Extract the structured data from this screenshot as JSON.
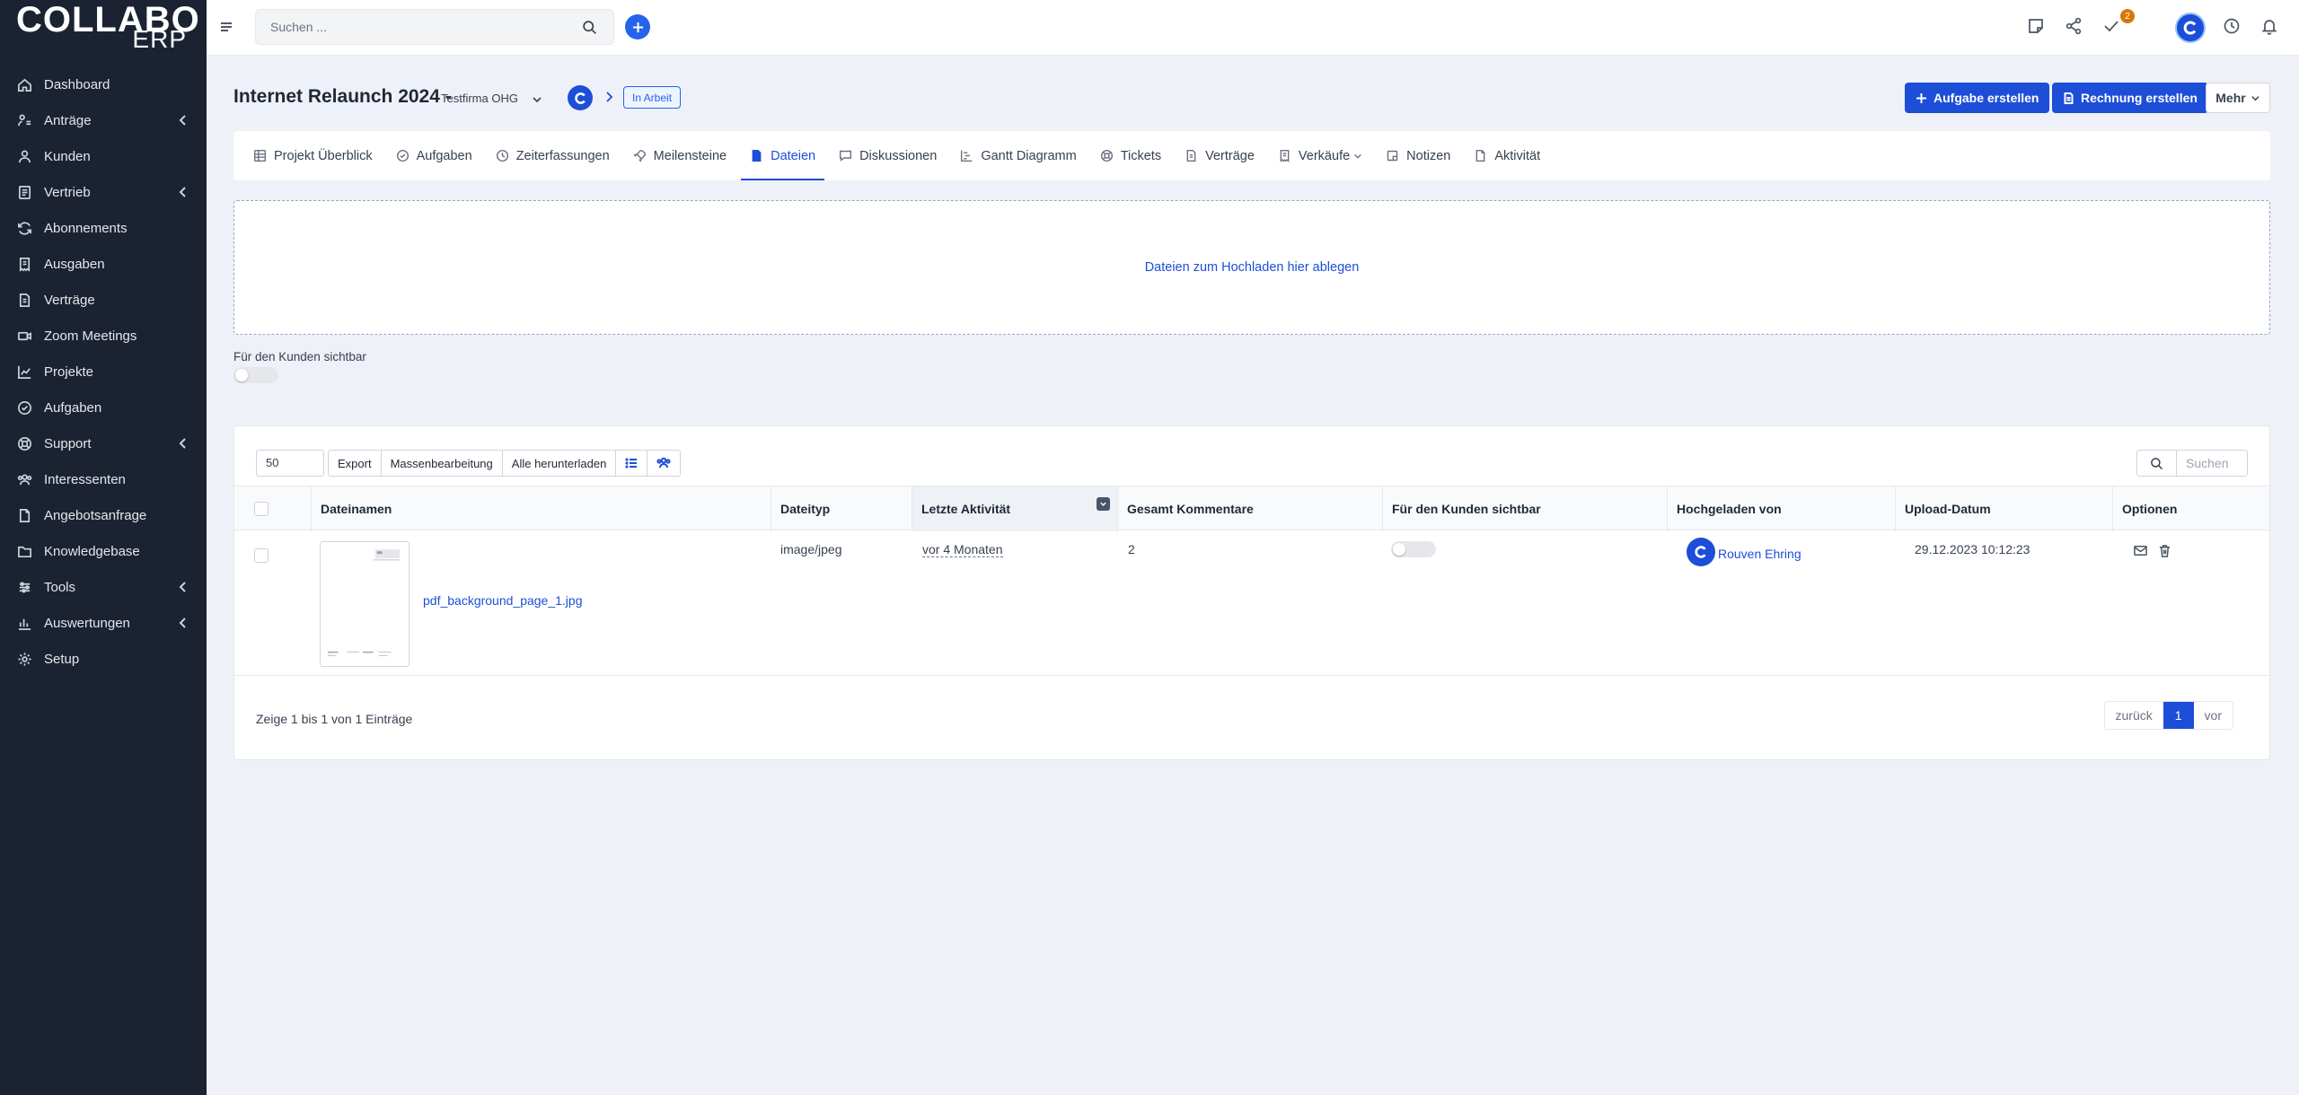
{
  "app": {
    "logo_main": "COLLABO",
    "logo_sub": "ERP"
  },
  "sidebar": {
    "items": [
      {
        "label": "Dashboard",
        "icon": "home-icon",
        "has_submenu": false
      },
      {
        "label": "Anträge",
        "icon": "request-icon",
        "has_submenu": true
      },
      {
        "label": "Kunden",
        "icon": "user-icon",
        "has_submenu": false
      },
      {
        "label": "Vertrieb",
        "icon": "sales-icon",
        "has_submenu": true
      },
      {
        "label": "Abonnements",
        "icon": "refresh-icon",
        "has_submenu": false
      },
      {
        "label": "Ausgaben",
        "icon": "receipt-icon",
        "has_submenu": false
      },
      {
        "label": "Verträge",
        "icon": "contract-icon",
        "has_submenu": false
      },
      {
        "label": "Zoom Meetings",
        "icon": "video-icon",
        "has_submenu": false
      },
      {
        "label": "Projekte",
        "icon": "chart-icon",
        "has_submenu": false
      },
      {
        "label": "Aufgaben",
        "icon": "check-circle-icon",
        "has_submenu": false
      },
      {
        "label": "Support",
        "icon": "lifebuoy-icon",
        "has_submenu": true
      },
      {
        "label": "Interessenten",
        "icon": "users-icon",
        "has_submenu": false
      },
      {
        "label": "Angebotsanfrage",
        "icon": "document-icon",
        "has_submenu": false
      },
      {
        "label": "Knowledgebase",
        "icon": "folder-icon",
        "has_submenu": false
      },
      {
        "label": "Tools",
        "icon": "tools-icon",
        "has_submenu": true
      },
      {
        "label": "Auswertungen",
        "icon": "bar-chart-icon",
        "has_submenu": true
      },
      {
        "label": "Setup",
        "icon": "gear-icon",
        "has_submenu": false
      }
    ]
  },
  "topbar": {
    "search_placeholder": "Suchen ...",
    "todo_badge": "2"
  },
  "project": {
    "title": "Internet Relaunch 2024",
    "separator": "-",
    "company": "Testfirma OHG",
    "status": "In Arbeit"
  },
  "actions": {
    "create_task": "Aufgabe erstellen",
    "create_invoice": "Rechnung erstellen",
    "more": "Mehr"
  },
  "tabs": [
    {
      "label": "Projekt Überblick",
      "icon": "grid-icon",
      "active": false
    },
    {
      "label": "Aufgaben",
      "icon": "check-circle-icon",
      "active": false
    },
    {
      "label": "Zeiterfassungen",
      "icon": "clock-icon",
      "active": false
    },
    {
      "label": "Meilensteine",
      "icon": "rocket-icon",
      "active": false
    },
    {
      "label": "Dateien",
      "icon": "file-icon",
      "active": true
    },
    {
      "label": "Diskussionen",
      "icon": "chat-icon",
      "active": false
    },
    {
      "label": "Gantt Diagramm",
      "icon": "gantt-icon",
      "active": false
    },
    {
      "label": "Tickets",
      "icon": "lifebuoy-icon",
      "active": false
    },
    {
      "label": "Verträge",
      "icon": "contract-icon",
      "active": false
    },
    {
      "label": "Verkäufe",
      "icon": "receipt-icon",
      "active": false
    },
    {
      "label": "Notizen",
      "icon": "note-icon",
      "active": false
    },
    {
      "label": "Aktivität",
      "icon": "document-icon",
      "active": false
    }
  ],
  "dropzone": {
    "text": "Dateien zum Hochladen hier ablegen"
  },
  "visibility": {
    "label": "Für den Kunden sichtbar",
    "on": false
  },
  "table": {
    "page_length": "50",
    "buttons": {
      "export": "Export",
      "bulk": "Massenbearbeitung",
      "download_all": "Alle herunterladen"
    },
    "search_placeholder": "Suchen",
    "columns": [
      "Dateinamen",
      "Dateityp",
      "Letzte Aktivität",
      "Gesamt Kommentare",
      "Für den Kunden sichtbar",
      "Hochgeladen von",
      "Upload-Datum",
      "Optionen"
    ],
    "rows": [
      {
        "filename": "pdf_background_page_1.jpg",
        "filetype": "image/jpeg",
        "last_activity": "vor 4 Monaten",
        "comments": "2",
        "visible": false,
        "uploaded_by": "Rouven Ehring",
        "upload_date": "29.12.2023 10:12:23"
      }
    ],
    "info": "Zeige 1 bis 1 von 1 Einträge",
    "pagination": {
      "prev": "zurück",
      "current": "1",
      "next": "vor"
    }
  },
  "colors": {
    "accent": "#1d4ed8",
    "sidebar_bg": "#1b2333",
    "page_bg": "#eef1f7",
    "badge": "#d97706"
  }
}
